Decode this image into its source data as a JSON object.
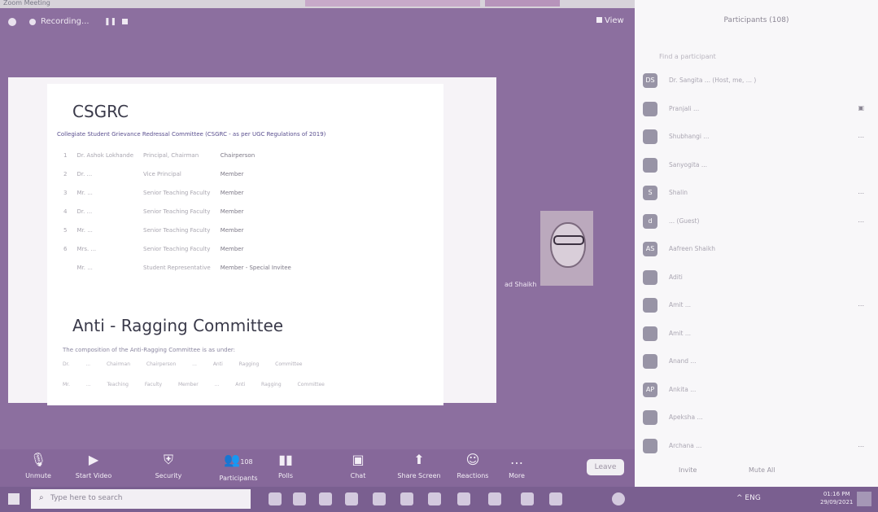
{
  "window": {
    "title": "Zoom Meeting"
  },
  "recording": {
    "label": "Recording...",
    "pause_icon": "pause-icon",
    "stop_icon": "stop-icon"
  },
  "view_label": "View",
  "slide": {
    "title": "CSGRC",
    "subtitle": "Collegiate Student Grievance Redressal Committee (CSGRC - as per UGC Regulations of 2019)",
    "rows": [
      {
        "no": "1",
        "name": "Dr. Ashok Lokhande",
        "desig": "Principal, Chairman",
        "role": "Chairperson"
      },
      {
        "no": "2",
        "name": "Dr. ...",
        "desig": "Vice Principal",
        "role": "Member"
      },
      {
        "no": "3",
        "name": "Mr. ...",
        "desig": "Senior Teaching Faculty",
        "role": "Member"
      },
      {
        "no": "4",
        "name": "Dr. ...",
        "desig": "Senior Teaching Faculty",
        "role": "Member"
      },
      {
        "no": "5",
        "name": "Mr. ...",
        "desig": "Senior Teaching Faculty",
        "role": "Member"
      },
      {
        "no": "6",
        "name": "Mrs. ...",
        "desig": "Senior Teaching Faculty",
        "role": "Member"
      },
      {
        "no": "",
        "name": "Mr. ...",
        "desig": "Student Representative",
        "role": "Member - Special Invitee"
      }
    ],
    "title2": "Anti - Ragging Committee",
    "subtitle2": "The composition of the Anti-Ragging Committee is as under:",
    "row2": "Dr. ... Chairman Chairperson ... Anti Ragging Committee",
    "row3": "Mr. ... Teaching Faculty Member ... Anti Ragging Committee"
  },
  "webcam": {
    "name": "ad Shaikh"
  },
  "toolbar": {
    "unmute": "Unmute",
    "start_video": "Start Video",
    "security": "Security",
    "participants": "Participants",
    "participants_count": "108",
    "polls": "Polls",
    "chat": "Chat",
    "share_screen": "Share Screen",
    "reactions": "Reactions",
    "more": "More",
    "leave": "Leave"
  },
  "panel": {
    "header": "Participants (108)",
    "search": "Find a participant",
    "participants": [
      {
        "initials": "DS",
        "name": "Dr. Sangita ... (Host, me, ... )",
        "extra": ""
      },
      {
        "initials": "",
        "name": "Pranjali ...",
        "extra": "▣"
      },
      {
        "initials": "",
        "name": "Shubhangi ...",
        "extra": "..."
      },
      {
        "initials": "",
        "name": "Sanyogita ...",
        "extra": ""
      },
      {
        "initials": "S",
        "name": "Shalin",
        "extra": "..."
      },
      {
        "initials": "d",
        "name": "... (Guest)",
        "extra": "..."
      },
      {
        "initials": "AS",
        "name": "Aafreen Shaikh",
        "extra": ""
      },
      {
        "initials": "",
        "name": "Aditi",
        "extra": ""
      },
      {
        "initials": "",
        "name": "Amit ...",
        "extra": "..."
      },
      {
        "initials": "",
        "name": "Amit ...",
        "extra": ""
      },
      {
        "initials": "",
        "name": "Anand ...",
        "extra": ""
      },
      {
        "initials": "AP",
        "name": "Ankita ...",
        "extra": ""
      },
      {
        "initials": "",
        "name": "Apeksha ...",
        "extra": ""
      },
      {
        "initials": "",
        "name": "Archana ...",
        "extra": "..."
      }
    ],
    "invite": "Invite",
    "mute_all": "Mute All"
  },
  "taskbar": {
    "search_placeholder": "Type here to search",
    "time": "01:16 PM",
    "date": "29/09/2021",
    "lang": "ENG"
  },
  "colors": {
    "zoom_bg": "#8c6f9f",
    "panel_bg": "#f8f7f9",
    "taskbar": "#7a5f90"
  }
}
